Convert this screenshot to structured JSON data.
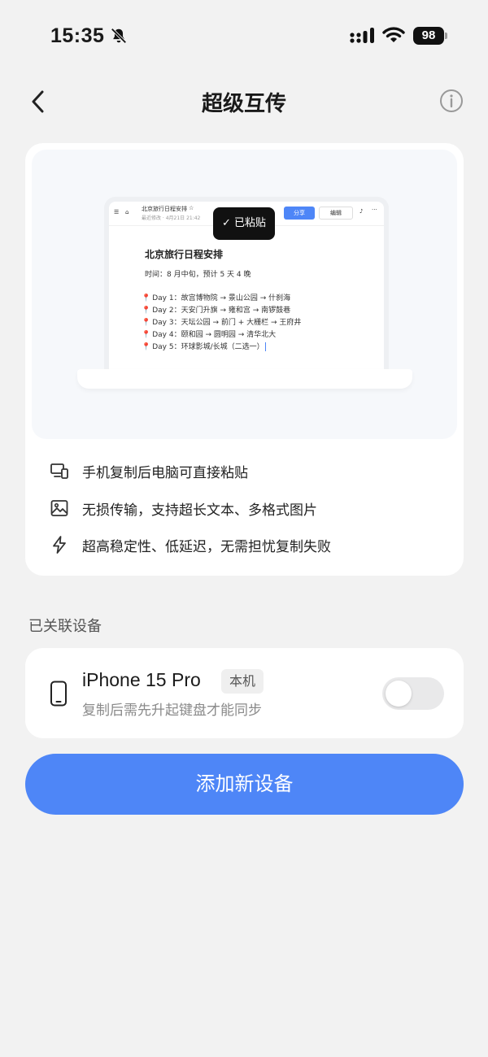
{
  "status_bar": {
    "time": "15:35",
    "battery": "98"
  },
  "nav": {
    "title": "超级互传"
  },
  "preview": {
    "doc_name": "北京旅行日程安排",
    "doc_meta": "最近修改 · 4月21日 21:42",
    "share_label": "分享",
    "edit_label": "编辑",
    "toast": "✓ 已粘贴",
    "doc_title": "北京旅行日程安排",
    "doc_subtitle": "时间：8 月中旬，预计 5 天 4 晚",
    "days": [
      "Day 1：故宫博物院 → 景山公园 → 什刹海",
      "Day 2：天安门升旗 → 雍和宫 → 南锣鼓巷",
      "Day 3：天坛公园 → 前门 + 大栅栏 → 王府井",
      "Day 4：颐和园 → 圆明园 → 清华北大",
      "Day 5：环球影城/长城（二选一）"
    ]
  },
  "features": [
    {
      "icon": "devices-icon",
      "text": "手机复制后电脑可直接粘贴"
    },
    {
      "icon": "image-icon",
      "text": "无损传输，支持超长文本、多格式图片"
    },
    {
      "icon": "lightning-icon",
      "text": "超高稳定性、低延迟，无需担忧复制失败"
    }
  ],
  "linked_devices": {
    "label": "已关联设备",
    "device": {
      "name": "iPhone 15 Pro",
      "badge": "本机",
      "description": "复制后需先升起键盘才能同步",
      "enabled": false
    }
  },
  "add_button": {
    "label": "添加新设备"
  },
  "colors": {
    "accent": "#4e86f7",
    "background": "#f2f2f2",
    "toggle_off": "#e9e9ea"
  }
}
